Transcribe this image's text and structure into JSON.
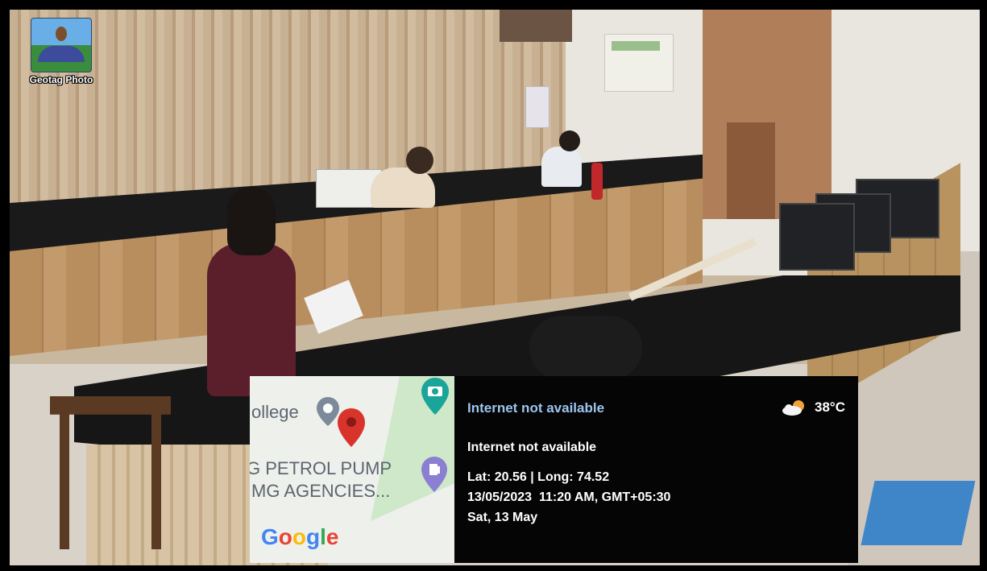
{
  "app_badge": {
    "label": "Geotag Photo",
    "icon": "geotag-photo-app-icon"
  },
  "map": {
    "labels": [
      "ollege",
      "G PETROL PUMP",
      "MG AGENCIES..."
    ],
    "attribution": "Google",
    "pins": [
      "location-pin-icon",
      "school-pin-icon",
      "camera-pin-icon",
      "fuel-pin-icon"
    ]
  },
  "info": {
    "title": "Internet not available",
    "weather_icon": "partly-cloudy-icon",
    "temperature": "38°C",
    "address": "Internet not available",
    "coordinates": "Lat: 20.56 | Long: 74.52",
    "datetime": "13/05/2023  11:20 AM, GMT+05:30",
    "day": "Sat, 13 May"
  },
  "colors": {
    "info_title": "#9ec4ee",
    "pin_red": "#d9342b",
    "google_blue": "#4285f4",
    "google_red": "#ea4335",
    "google_yellow": "#fbbc05",
    "google_green": "#34a853"
  }
}
